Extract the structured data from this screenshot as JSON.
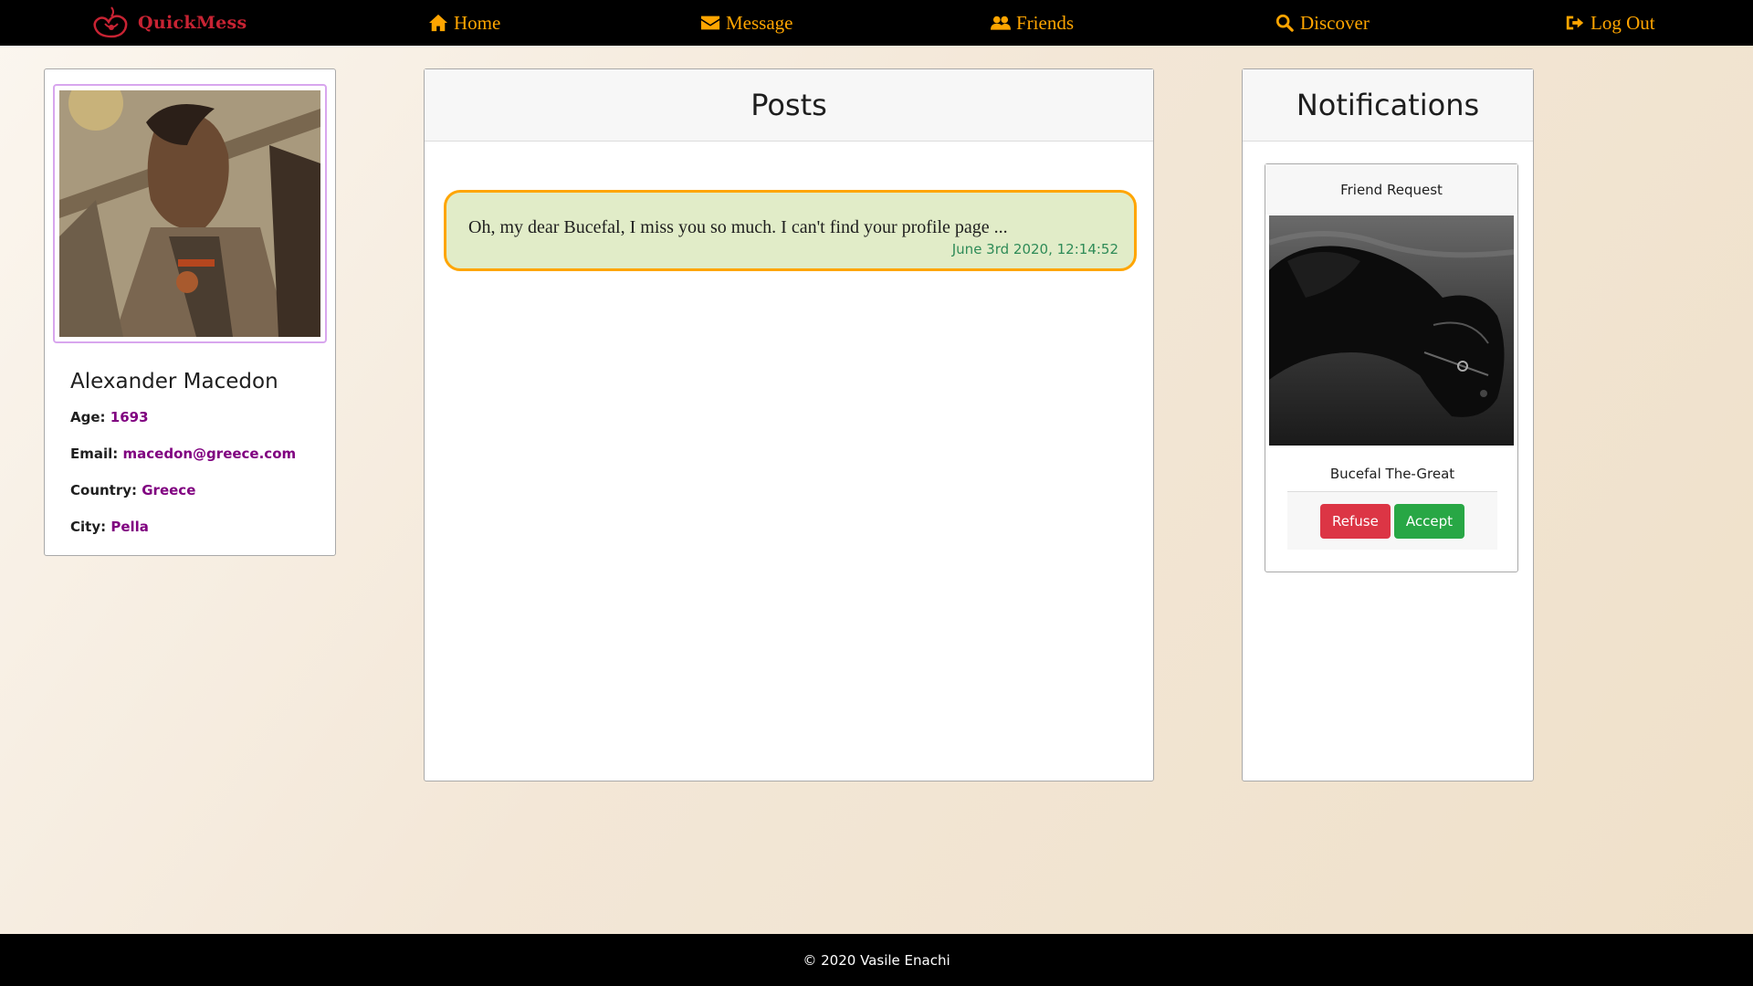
{
  "navbar": {
    "brand": "QuickMess",
    "items": [
      {
        "label": "Home",
        "icon": "home-icon"
      },
      {
        "label": "Message",
        "icon": "envelope-icon"
      },
      {
        "label": "Friends",
        "icon": "users-icon"
      },
      {
        "label": "Discover",
        "icon": "search-icon"
      },
      {
        "label": "Log Out",
        "icon": "sign-out-icon"
      }
    ]
  },
  "profile": {
    "name": "Alexander Macedon",
    "age_label": "Age:",
    "age": "1693",
    "email_label": "Email:",
    "email": "macedon@greece.com",
    "country_label": "Country:",
    "country": "Greece",
    "city_label": "City:",
    "city": "Pella"
  },
  "posts": {
    "title": "Posts",
    "items": [
      {
        "text": "Oh, my dear Bucefal, I miss you so much. I can't find your profile page ...",
        "time": "June 3rd 2020, 12:14:52"
      }
    ]
  },
  "notifications": {
    "title": "Notifications",
    "request": {
      "heading": "Friend Request",
      "name": "Bucefal The-Great",
      "refuse_label": "Refuse",
      "accept_label": "Accept"
    }
  },
  "footer": {
    "text": "© 2020 Vasile Enachi"
  },
  "colors": {
    "nav_bg": "#000000",
    "nav_text": "#ffa500",
    "brand": "#c82333",
    "post_bg": "#e1ecc8",
    "post_border": "#ffa500",
    "post_time": "#2e8b57",
    "profile_value": "#800080",
    "refuse": "#dc3545",
    "accept": "#28a745"
  }
}
